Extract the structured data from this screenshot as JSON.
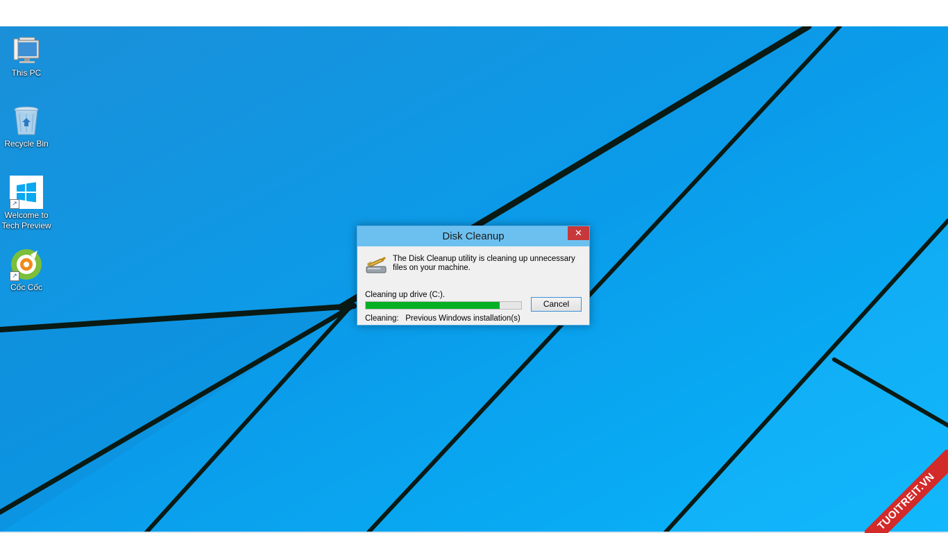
{
  "desktop": {
    "icons": [
      {
        "label": "This PC",
        "icon": "this-pc-icon"
      },
      {
        "label": "Recycle Bin",
        "icon": "recycle-bin-icon"
      },
      {
        "label_line1": "Welcome to",
        "label_line2": "Tech Preview",
        "icon": "windows-logo-icon",
        "shortcut": true
      },
      {
        "label": "Cốc Cốc",
        "icon": "coc-coc-browser-icon",
        "shortcut": true
      }
    ],
    "accent": "#0ea5f0"
  },
  "dialog": {
    "title": "Disk Cleanup",
    "close_glyph": "✕",
    "message": "The Disk Cleanup utility is cleaning up unnecessary files on your machine.",
    "drive_text": "Cleaning up drive  (C:).",
    "progress_percent": 86,
    "cancel_label": "Cancel",
    "status_label": "Cleaning:",
    "status_value": "Previous Windows installation(s)",
    "colors": {
      "titlebar": "#6cc0f0",
      "close": "#c7383a",
      "progress": "#06b025"
    }
  },
  "watermark": {
    "text": "TUOITREIT.VN",
    "color": "#d32a2a"
  }
}
